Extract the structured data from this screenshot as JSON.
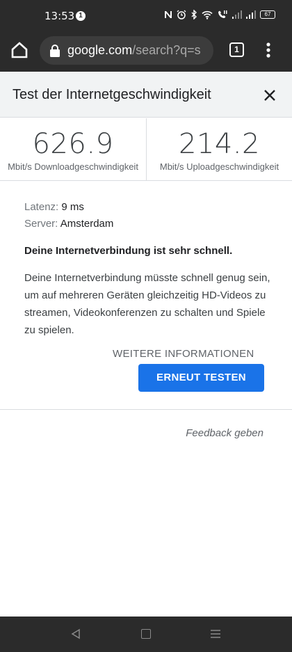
{
  "status_bar": {
    "time": "13:53",
    "notification_count": "1",
    "battery": "67",
    "icons": [
      "nfc-icon",
      "alarm-icon",
      "bluetooth-icon",
      "wifi-icon",
      "volte-icon",
      "signal-icon",
      "signal-icon",
      "battery-icon"
    ]
  },
  "browser": {
    "url_domain": "google.com",
    "url_path": "/search?q=s",
    "tab_count": "1"
  },
  "sheet": {
    "title": "Test der Internetgeschwindigkeit"
  },
  "speeds": {
    "download_value": "626.9",
    "download_label": "Mbit/s Downloadgeschwindigkeit",
    "upload_value": "214.2",
    "upload_label": "Mbit/s Uploadgeschwindigkeit"
  },
  "details": {
    "latency_key": "Latenz:",
    "latency_value": "9 ms",
    "server_key": "Server:",
    "server_value": "Amsterdam",
    "verdict": "Deine Internetverbindung ist sehr schnell.",
    "description": "Deine Internetverbindung müsste schnell genug sein, um auf mehreren Geräten gleichzeitig HD-Videos zu streamen, Videokonferenzen zu schalten und Spiele zu spielen."
  },
  "actions": {
    "more_info": "WEITERE INFORMATIONEN",
    "retest": "ERNEUT TESTEN",
    "feedback": "Feedback geben"
  },
  "colors": {
    "accent": "#1a73e8",
    "chrome_dark": "#2b2b2b",
    "sheet_header": "#f1f3f4"
  }
}
